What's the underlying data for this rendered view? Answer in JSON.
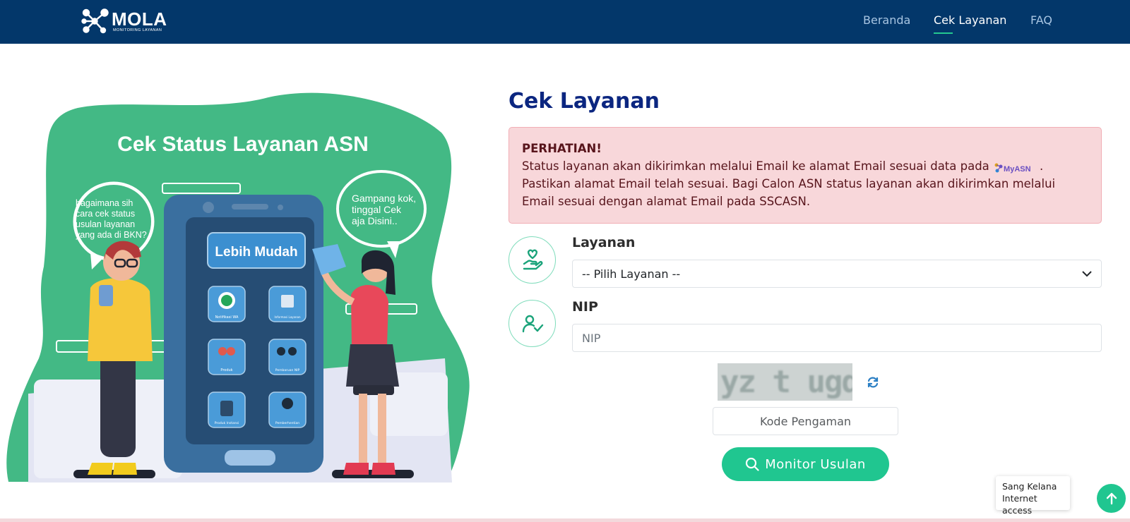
{
  "header": {
    "logo": {
      "name": "MOLA",
      "tagline": "MONITORING LAYANAN"
    },
    "nav": [
      {
        "label": "Beranda",
        "active": false
      },
      {
        "label": "Cek Layanan",
        "active": true
      },
      {
        "label": "FAQ",
        "active": false
      }
    ]
  },
  "hero": {
    "heading": "Cek Status Layanan ASN",
    "bubble_left": [
      "bagaimana sih",
      "cara cek status",
      "usulan layanan",
      "yang ada di BKN?"
    ],
    "bubble_right": [
      "Gampang kok,",
      "tinggal Cek",
      "aja Disini.."
    ],
    "phone_banner": "Lebih Mudah",
    "app_icons": [
      "Notifikasi WA",
      "Informasi Layanan",
      "Produk",
      "Pembaruan NIP",
      "Produk Instansi",
      "Pemberhentian"
    ]
  },
  "main": {
    "title": "Cek Layanan",
    "alert": {
      "heading": "PERHATIAN!",
      "text_before_logo": "Status layanan akan dikirimkan melalui Email ke alamat Email sesuai data pada ",
      "logo_label": "MyASN",
      "text_after_logo": ". Pastikan alamat Email telah sesuai. Bagi Calon ASN status layanan akan dikirimkan melalui Email sesuai dengan alamat Email pada SSCASN."
    },
    "layanan": {
      "label": "Layanan",
      "selected": "-- Pilih Layanan --"
    },
    "nip": {
      "label": "NIP",
      "placeholder": "NIP"
    },
    "captcha": {
      "text": "yz t ugq"
    },
    "kode": {
      "placeholder": "Kode Pengaman"
    },
    "submit_label": "Monitor Usulan"
  },
  "toast": {
    "lines": [
      "Sang Kelana",
      "Internet access"
    ]
  },
  "colors": {
    "navbar": "#03376a",
    "accent": "#20c690",
    "title": "#0b2680",
    "alert_bg": "#f8d7da"
  }
}
